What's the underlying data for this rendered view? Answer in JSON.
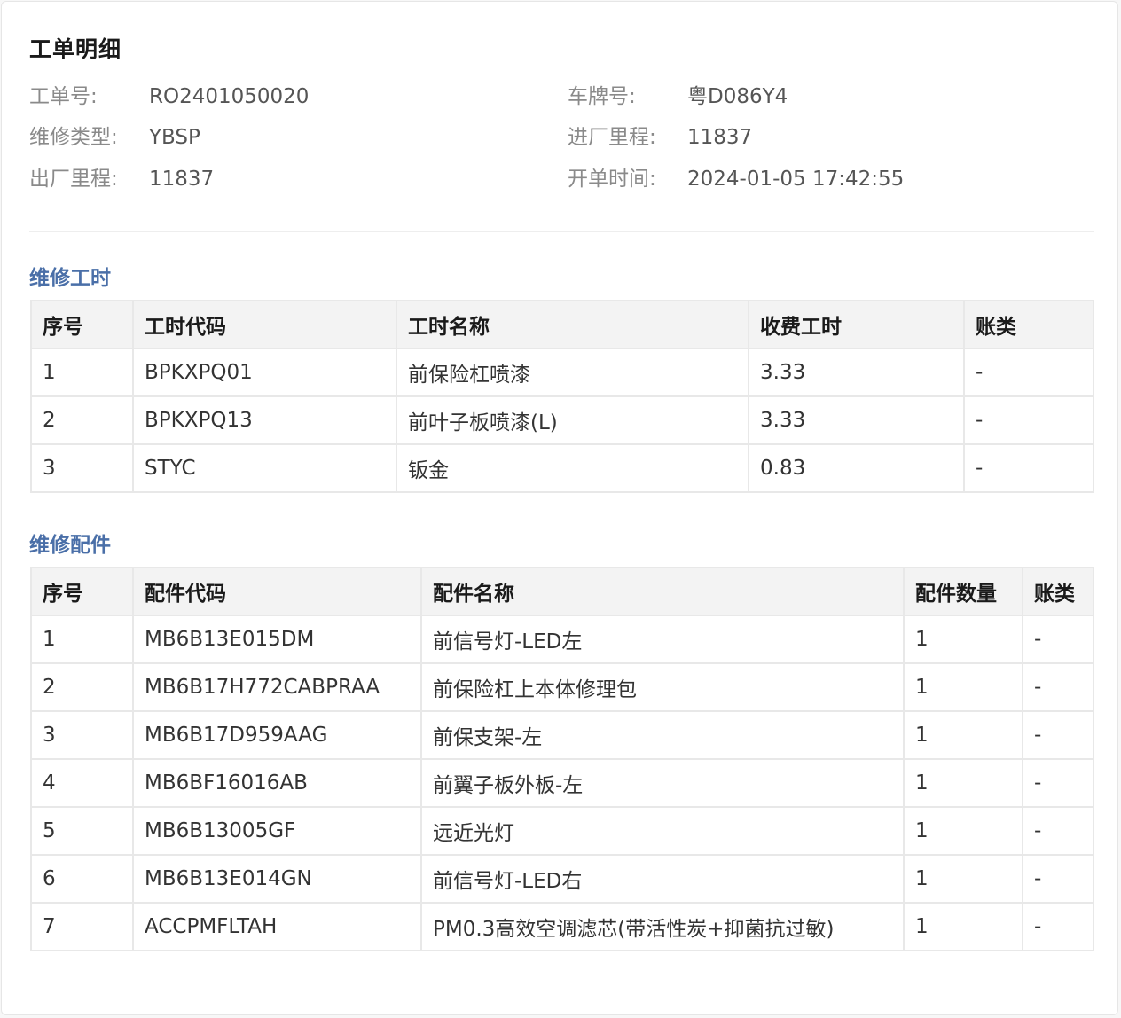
{
  "title": "工单明细",
  "info": {
    "order_no_label": "工单号:",
    "order_no": "RO2401050020",
    "plate_label": "车牌号:",
    "plate": "粤D086Y4",
    "repair_type_label": "维修类型:",
    "repair_type": "YBSP",
    "in_mileage_label": "进厂里程:",
    "in_mileage": "11837",
    "out_mileage_label": "出厂里程:",
    "out_mileage": "11837",
    "open_time_label": "开单时间:",
    "open_time": "2024-01-05 17:42:55"
  },
  "labor": {
    "title": "维修工时",
    "headers": [
      "序号",
      "工时代码",
      "工时名称",
      "收费工时",
      "账类"
    ],
    "rows": [
      [
        "1",
        "BPKXPQ01",
        "前保险杠喷漆",
        "3.33",
        "-"
      ],
      [
        "2",
        "BPKXPQ13",
        "前叶子板喷漆(L)",
        "3.33",
        "-"
      ],
      [
        "3",
        "STYC",
        "钣金",
        "0.83",
        "-"
      ]
    ]
  },
  "parts": {
    "title": "维修配件",
    "headers": [
      "序号",
      "配件代码",
      "配件名称",
      "配件数量",
      "账类"
    ],
    "rows": [
      [
        "1",
        "MB6B13E015DM",
        "前信号灯-LED左",
        "1",
        "-"
      ],
      [
        "2",
        "MB6B17H772CABPRAA",
        "前保险杠上本体修理包",
        "1",
        "-"
      ],
      [
        "3",
        "MB6B17D959AAG",
        "前保支架-左",
        "1",
        "-"
      ],
      [
        "4",
        "MB6BF16016AB",
        "前翼子板外板-左",
        "1",
        "-"
      ],
      [
        "5",
        "MB6B13005GF",
        "远近光灯",
        "1",
        "-"
      ],
      [
        "6",
        "MB6B13E014GN",
        "前信号灯-LED右",
        "1",
        "-"
      ],
      [
        "7",
        "ACCPMFLTAH",
        "PM0.3高效空调滤芯(带活性炭+抑菌抗过敏)",
        "1",
        "-"
      ]
    ]
  },
  "colors": {
    "section_title": "#4a6fa8",
    "header_bg": "#f3f3f3",
    "label": "#8a8a8a"
  }
}
